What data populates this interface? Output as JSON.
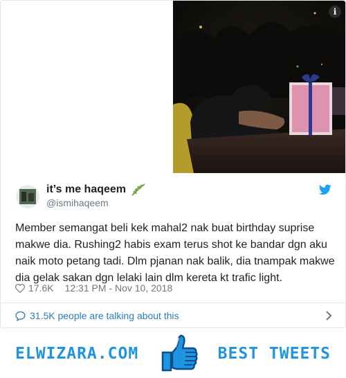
{
  "tweet": {
    "name": "it’s me haqeem",
    "handle": "@ismihaqeem",
    "text": "Member semangat beli kek mahal2 nak buat birthday suprise makwe dia. Rushing2 habis exam terus shot ke bandar dgn aku naik moto petang tadi. Dlm pjanan nak balik, dia tnampak makwe dia gelak sakan dgn lelaki lain dlm kereta kt trafic light.",
    "likes": "17.6K",
    "timestamp": "12:31 PM - Nov 10, 2018",
    "info_icon_label": "i",
    "talking": "31.5K people are talking about this"
  },
  "footer": {
    "left_brand": "ELWIZARA.COM",
    "right_brand": "BEST TWEETS"
  },
  "colors": {
    "accent": "#2b7bb9",
    "brand": "#1f94e0",
    "twitter_blue": "#1da1f2",
    "muted": "#697882",
    "text": "#1c2022"
  }
}
